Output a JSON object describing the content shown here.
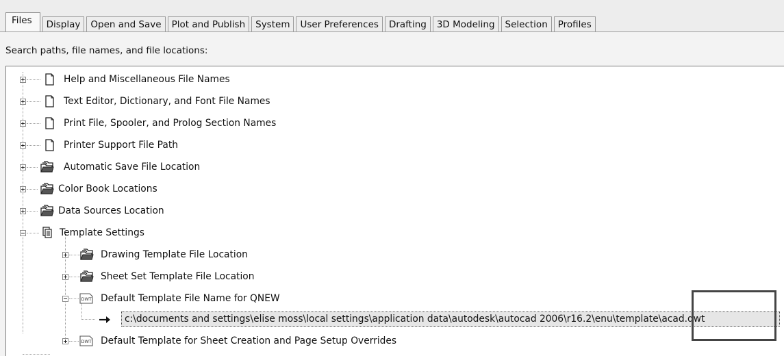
{
  "tabs": [
    {
      "label": "Files",
      "active": true
    },
    {
      "label": "Display"
    },
    {
      "label": "Open and Save"
    },
    {
      "label": "Plot and Publish"
    },
    {
      "label": "System"
    },
    {
      "label": "User Preferences"
    },
    {
      "label": "Drafting"
    },
    {
      "label": "3D Modeling"
    },
    {
      "label": "Selection"
    },
    {
      "label": "Profiles"
    }
  ],
  "section_label": "Search paths, file names, and file locations:",
  "tree": {
    "items": [
      {
        "label": "Help and Miscellaneous File Names",
        "icon": "document-icon",
        "state": "collapsed"
      },
      {
        "label": "Text Editor, Dictionary, and Font File Names",
        "icon": "document-icon",
        "state": "collapsed"
      },
      {
        "label": "Print File, Spooler, and Prolog Section Names",
        "icon": "document-icon",
        "state": "collapsed"
      },
      {
        "label": "Printer Support File Path",
        "icon": "document-icon",
        "state": "collapsed"
      },
      {
        "label": "Automatic Save File Location",
        "icon": "folder-stack-icon",
        "state": "collapsed"
      },
      {
        "label": "Color Book Locations",
        "icon": "folder-stack-icon",
        "state": "collapsed"
      },
      {
        "label": "Data Sources Location",
        "icon": "folder-stack-icon",
        "state": "collapsed"
      },
      {
        "label": "Template Settings",
        "icon": "template-settings-icon",
        "state": "expanded"
      }
    ],
    "template_children": [
      {
        "label": "Drawing Template File Location",
        "icon": "folder-stack-icon",
        "state": "collapsed"
      },
      {
        "label": "Sheet Set Template File Location",
        "icon": "folder-stack-icon",
        "state": "collapsed"
      },
      {
        "label": "Default Template File Name for QNEW",
        "icon": "dwt-file-icon",
        "state": "expanded"
      },
      {
        "label": "Default Template for Sheet Creation and Page Setup Overrides",
        "icon": "dwt-file-icon",
        "state": "collapsed"
      }
    ],
    "selected_path": "c:\\documents and settings\\elise moss\\local settings\\application data\\autodesk\\autocad 2006\\r16.2\\enu\\template\\acad.dwt",
    "selected_icon": "arrow-right-icon"
  },
  "colors": {
    "tab_background": "#ededed",
    "tree_background": "#ffffff",
    "selection_background": "#e6e6e6",
    "highlight_border": "#444444"
  }
}
